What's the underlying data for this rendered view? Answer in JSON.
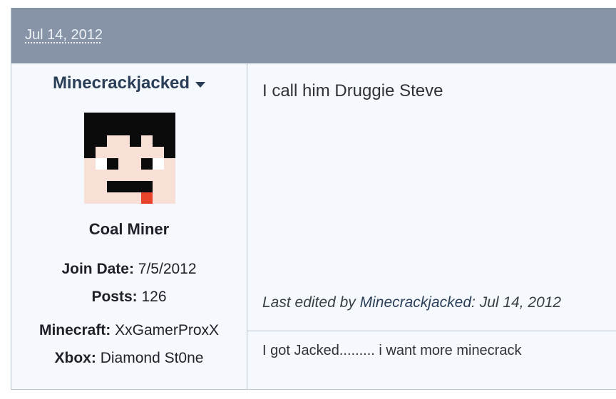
{
  "post": {
    "date": "Jul 14, 2012",
    "user": {
      "name": "Minecrackjacked",
      "rank": "Coal Miner",
      "join_date_label": "Join Date:",
      "join_date": "7/5/2012",
      "posts_label": "Posts:",
      "posts": "126",
      "minecraft_label": "Minecraft:",
      "minecraft": "XxGamerProxX",
      "xbox_label": "Xbox:",
      "xbox": "Diamond St0ne"
    },
    "message": "I call him Druggie Steve",
    "edited_prefix": "Last edited by",
    "edited_by": "Minecrackjacked",
    "edited_date": "Jul 14, 2012",
    "signature": "I got Jacked......... i want more minecrack"
  },
  "colors": {
    "header": "#8794a8",
    "background": "#f5f8fd",
    "username": "#2b3e58",
    "border": "#b8c3d0"
  }
}
